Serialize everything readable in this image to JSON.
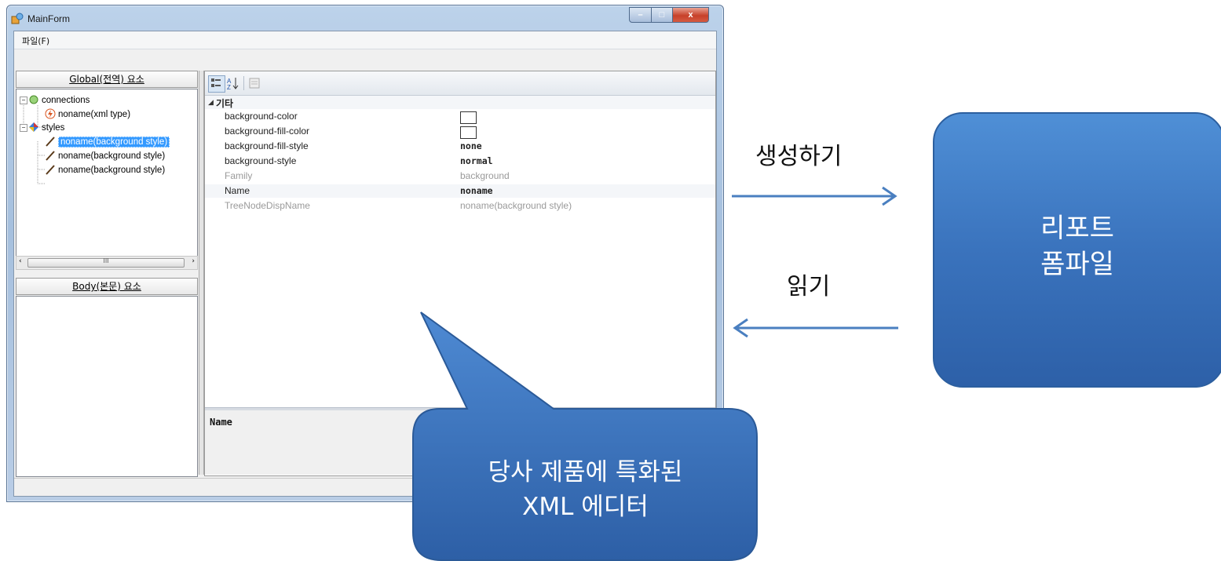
{
  "window": {
    "title": "MainForm",
    "menu_file": "파일(F)",
    "controls": {
      "minimize": "–",
      "maximize": "□",
      "close": "x"
    }
  },
  "global_panel": {
    "header": "Global(전역) 요소",
    "tree": [
      {
        "label": "connections",
        "icon": "connections-icon"
      },
      {
        "label": "noname(xml type)",
        "icon": "lightning-icon"
      },
      {
        "label": "styles",
        "icon": "styles-icon"
      },
      {
        "label": "noname(background style)",
        "icon": "brush-icon",
        "selected": true
      },
      {
        "label": "noname(background style)",
        "icon": "brush-icon"
      },
      {
        "label": "noname(background style)",
        "icon": "brush-icon"
      }
    ],
    "scroll_thumb": "III"
  },
  "body_panel": {
    "header": "Body(본문) 요소"
  },
  "property_grid": {
    "category": "기타",
    "rows": [
      {
        "name": "background-color",
        "value": "",
        "swatch": true
      },
      {
        "name": "background-fill-color",
        "value": "",
        "swatch": true
      },
      {
        "name": "background-fill-style",
        "value": "none",
        "bold": true
      },
      {
        "name": "background-style",
        "value": "normal",
        "bold": true
      },
      {
        "name": "Family",
        "value": "background",
        "dim": true
      },
      {
        "name": "Name",
        "value": "noname",
        "bold": true
      },
      {
        "name": "TreeNodeDispName",
        "value": "noname(background style)",
        "dim": true
      }
    ],
    "description_title": "Name"
  },
  "annotations": {
    "create_label": "생성하기",
    "read_label": "읽기",
    "report_box": [
      "리포트",
      "폼파일"
    ],
    "callout": [
      "당사 제품에 특화된",
      "XML 에디터"
    ]
  },
  "colors": {
    "accent_blue": "#3a73bd",
    "arrow_blue": "#4a7fc0",
    "selection": "#3399ff"
  }
}
